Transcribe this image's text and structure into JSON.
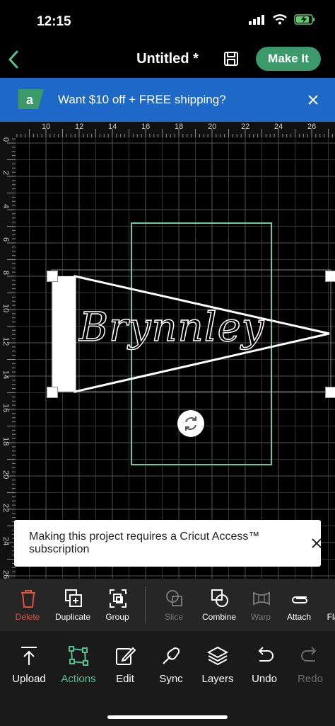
{
  "status": {
    "time": "12:15"
  },
  "header": {
    "title": "Untitled *",
    "make_it": "Make It"
  },
  "banner": {
    "text": "Want $10 off + FREE shipping?"
  },
  "canvas": {
    "top_ruler_labels": [
      "10",
      "12",
      "14",
      "16",
      "18",
      "20",
      "22",
      "24",
      "26"
    ],
    "left_ruler_labels": [
      "0",
      "2",
      "4",
      "6",
      "8",
      "10",
      "12",
      "14",
      "16",
      "18",
      "20",
      "22",
      "24",
      "26"
    ],
    "design_text": "Brynnley"
  },
  "toast": {
    "text": "Making this project requires a Cricut Access™ subscription"
  },
  "actions": [
    {
      "label": "Delete",
      "icon": "trash-icon"
    },
    {
      "label": "Duplicate",
      "icon": "duplicate-icon"
    },
    {
      "label": "Group",
      "icon": "group-icon"
    },
    {
      "label": "Slice",
      "icon": "slice-icon"
    },
    {
      "label": "Combine",
      "icon": "combine-icon"
    },
    {
      "label": "Warp",
      "icon": "warp-icon"
    },
    {
      "label": "Attach",
      "icon": "paperclip-icon"
    },
    {
      "label": "Fla",
      "icon": "flatten-icon"
    }
  ],
  "nav": [
    {
      "label": "Upload",
      "icon": "upload-icon"
    },
    {
      "label": "Actions",
      "icon": "actions-icon"
    },
    {
      "label": "Edit",
      "icon": "edit-icon"
    },
    {
      "label": "Sync",
      "icon": "sync-icon"
    },
    {
      "label": "Layers",
      "icon": "layers-icon"
    },
    {
      "label": "Undo",
      "icon": "undo-icon"
    },
    {
      "label": "Redo",
      "icon": "redo-icon"
    }
  ],
  "colors": {
    "accent": "#3c9a6a",
    "banner": "#1e68c8",
    "delete": "#e0523a",
    "active": "#54c191"
  }
}
